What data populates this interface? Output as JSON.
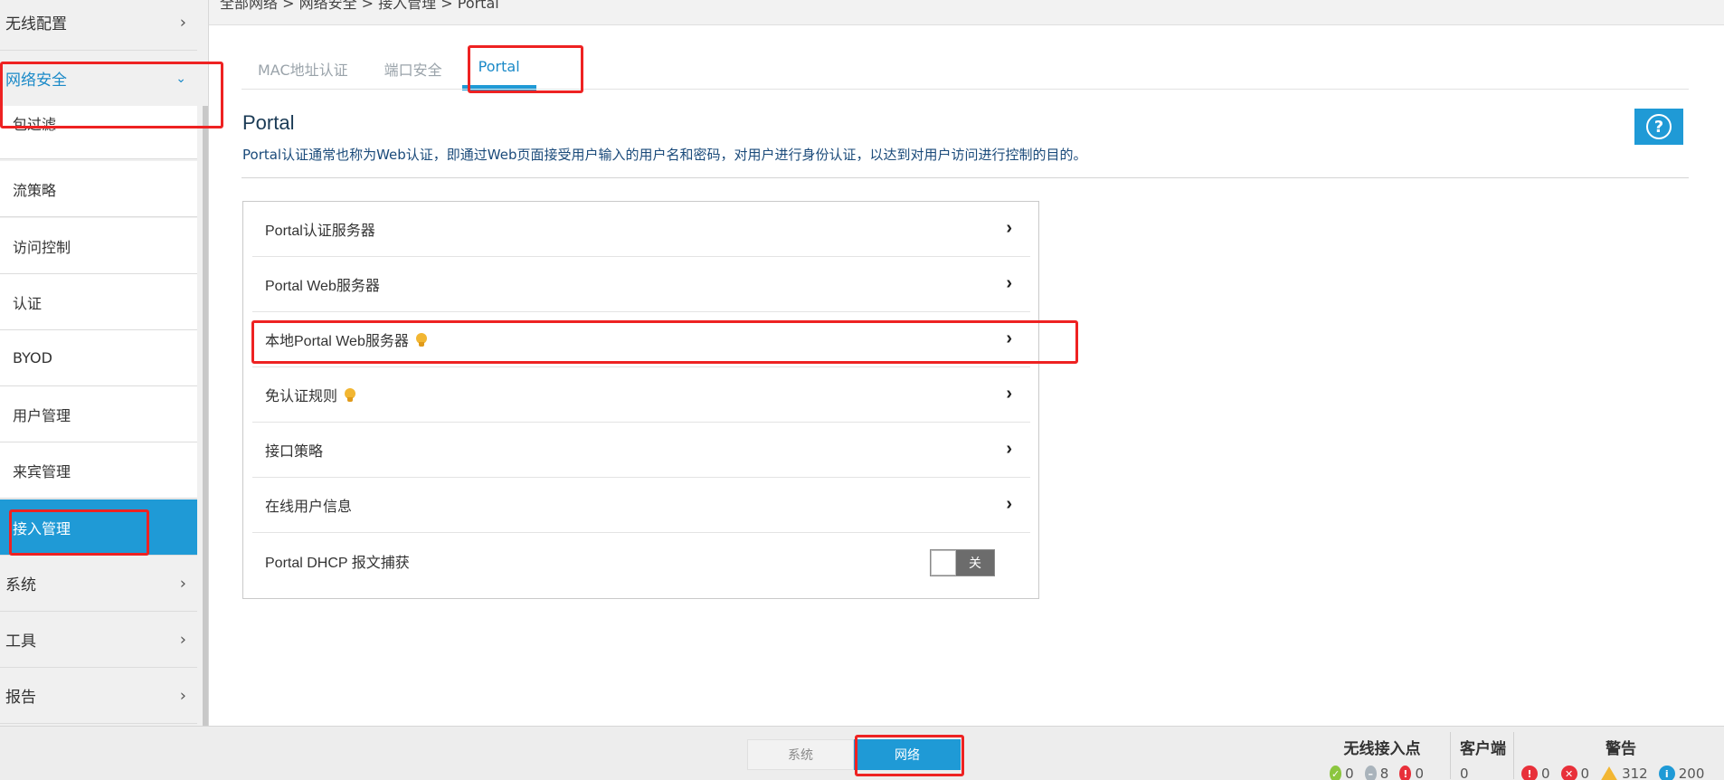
{
  "breadcrumb": "全部网络 > 网络安全 > 接入管理 > Portal",
  "sidebar": {
    "top_items": [
      {
        "label": "无线配置"
      },
      {
        "label": "网络安全"
      },
      {
        "label": "系统"
      },
      {
        "label": "工具"
      },
      {
        "label": "报告"
      }
    ],
    "sub_items": [
      {
        "label": "包过滤"
      },
      {
        "label": "流策略"
      },
      {
        "label": "访问控制"
      },
      {
        "label": "认证"
      },
      {
        "label": "BYOD"
      },
      {
        "label": "用户管理"
      },
      {
        "label": "来宾管理"
      },
      {
        "label": "接入管理"
      }
    ],
    "selected": "接入管理"
  },
  "tabs": [
    {
      "label": "MAC地址认证"
    },
    {
      "label": "端口安全"
    },
    {
      "label": "Portal"
    }
  ],
  "active_tab": "Portal",
  "page": {
    "title": "Portal",
    "description": "Portal认证通常也称为Web认证，即通过Web页面接受用户输入的用户名和密码，对用户进行身份认证，以达到对用户访问进行控制的目的。",
    "help_icon": "?"
  },
  "rows": [
    {
      "label": "Portal认证服务器"
    },
    {
      "label": "Portal Web服务器"
    },
    {
      "label": "本地Portal Web服务器"
    },
    {
      "label": "免认证规则"
    },
    {
      "label": "接口策略"
    },
    {
      "label": "在线用户信息"
    },
    {
      "label": "Portal DHCP 报文捕获"
    }
  ],
  "toggle": {
    "label": "关",
    "state": "off"
  },
  "bottom": {
    "modes": [
      {
        "label": "系统"
      },
      {
        "label": "网络"
      }
    ],
    "active_mode": "网络",
    "ap": {
      "title": "无线接入点",
      "ok": "0",
      "minus": "8",
      "err": "0"
    },
    "clients": {
      "title": "客户端",
      "count": "0"
    },
    "alerts": {
      "title": "警告",
      "critical": "0",
      "error": "0",
      "warning": "312",
      "info": "200"
    }
  },
  "colors": {
    "accent": "#1f9ad6",
    "highlight": "#ee2222",
    "bulb": "#f2b632"
  }
}
